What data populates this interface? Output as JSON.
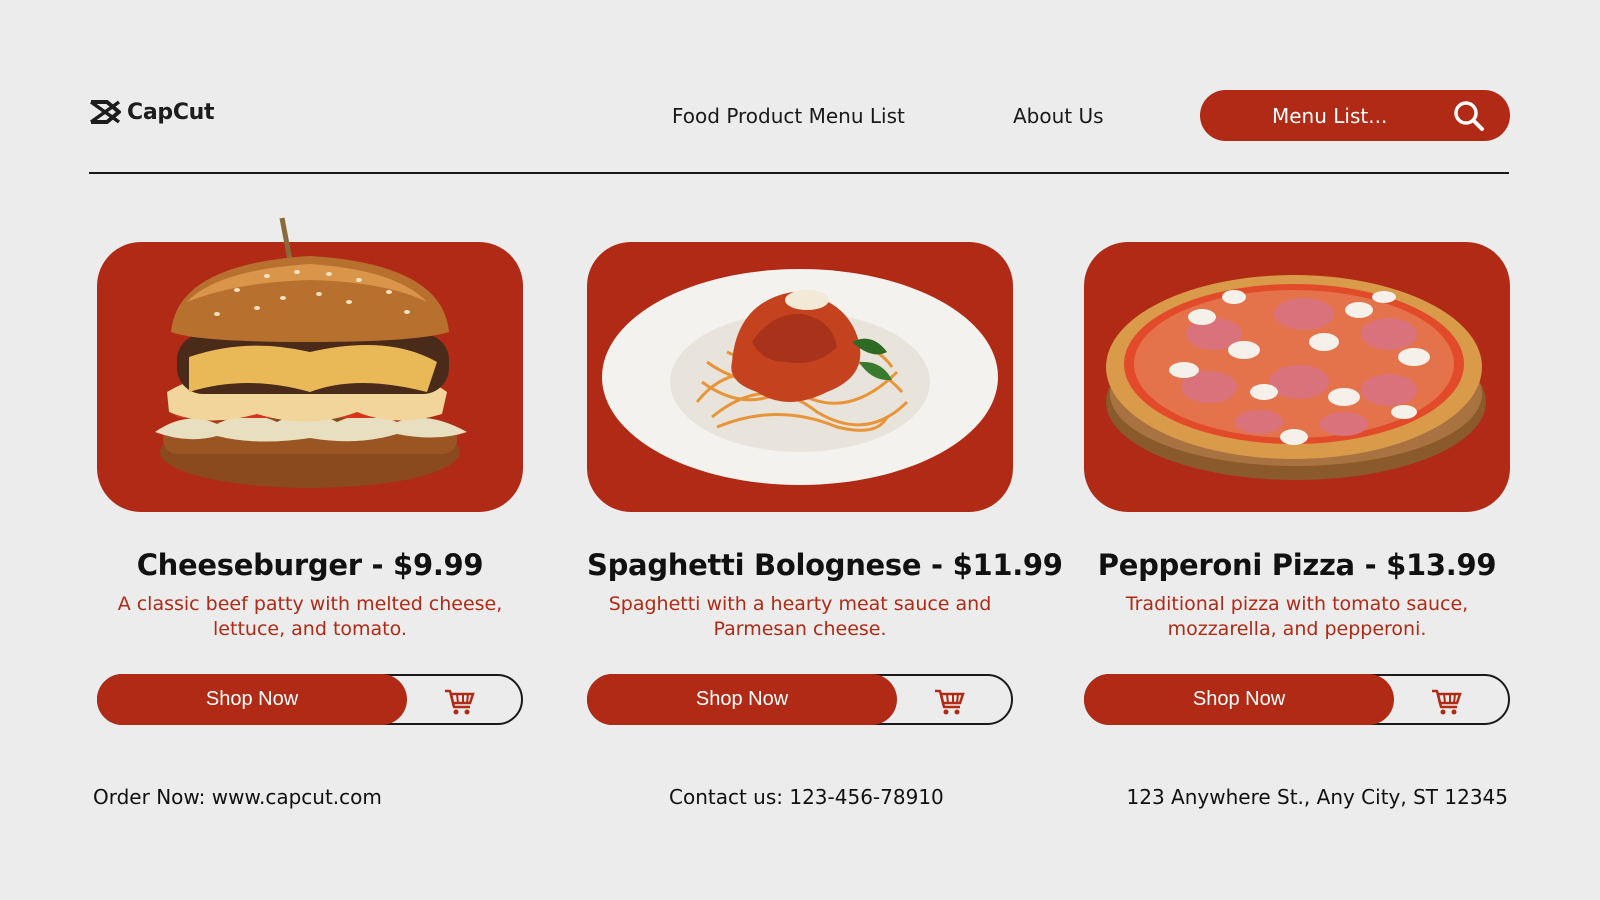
{
  "brand": {
    "name": "CapCut",
    "accent_color": "#b02a15",
    "logo_icon": "capcut-logo-icon"
  },
  "nav": {
    "links": [
      "Food Product Menu List",
      "About Us"
    ],
    "search": {
      "label": "Menu List...",
      "icon": "search-icon"
    }
  },
  "products": [
    {
      "title": "Cheeseburger - $9.99",
      "description": "A classic beef patty with melted cheese, lettuce, and tomato.",
      "image": "cheeseburger-image",
      "button": "Shop Now",
      "cart_icon": "cart-icon"
    },
    {
      "title": "Spaghetti Bolognese - $11.99",
      "description": "Spaghetti with a hearty meat sauce and Parmesan cheese.",
      "image": "spaghetti-image",
      "button": "Shop Now",
      "cart_icon": "cart-icon"
    },
    {
      "title": "Pepperoni Pizza - $13.99",
      "description": "Traditional pizza with tomato sauce, mozzarella, and pepperoni.",
      "image": "pizza-image",
      "button": "Shop Now",
      "cart_icon": "cart-icon"
    }
  ],
  "footer": {
    "order": "Order Now: www.capcut.com",
    "contact": "Contact us:  123-456-78910",
    "address": "123 Anywhere St., Any City, ST 12345"
  }
}
